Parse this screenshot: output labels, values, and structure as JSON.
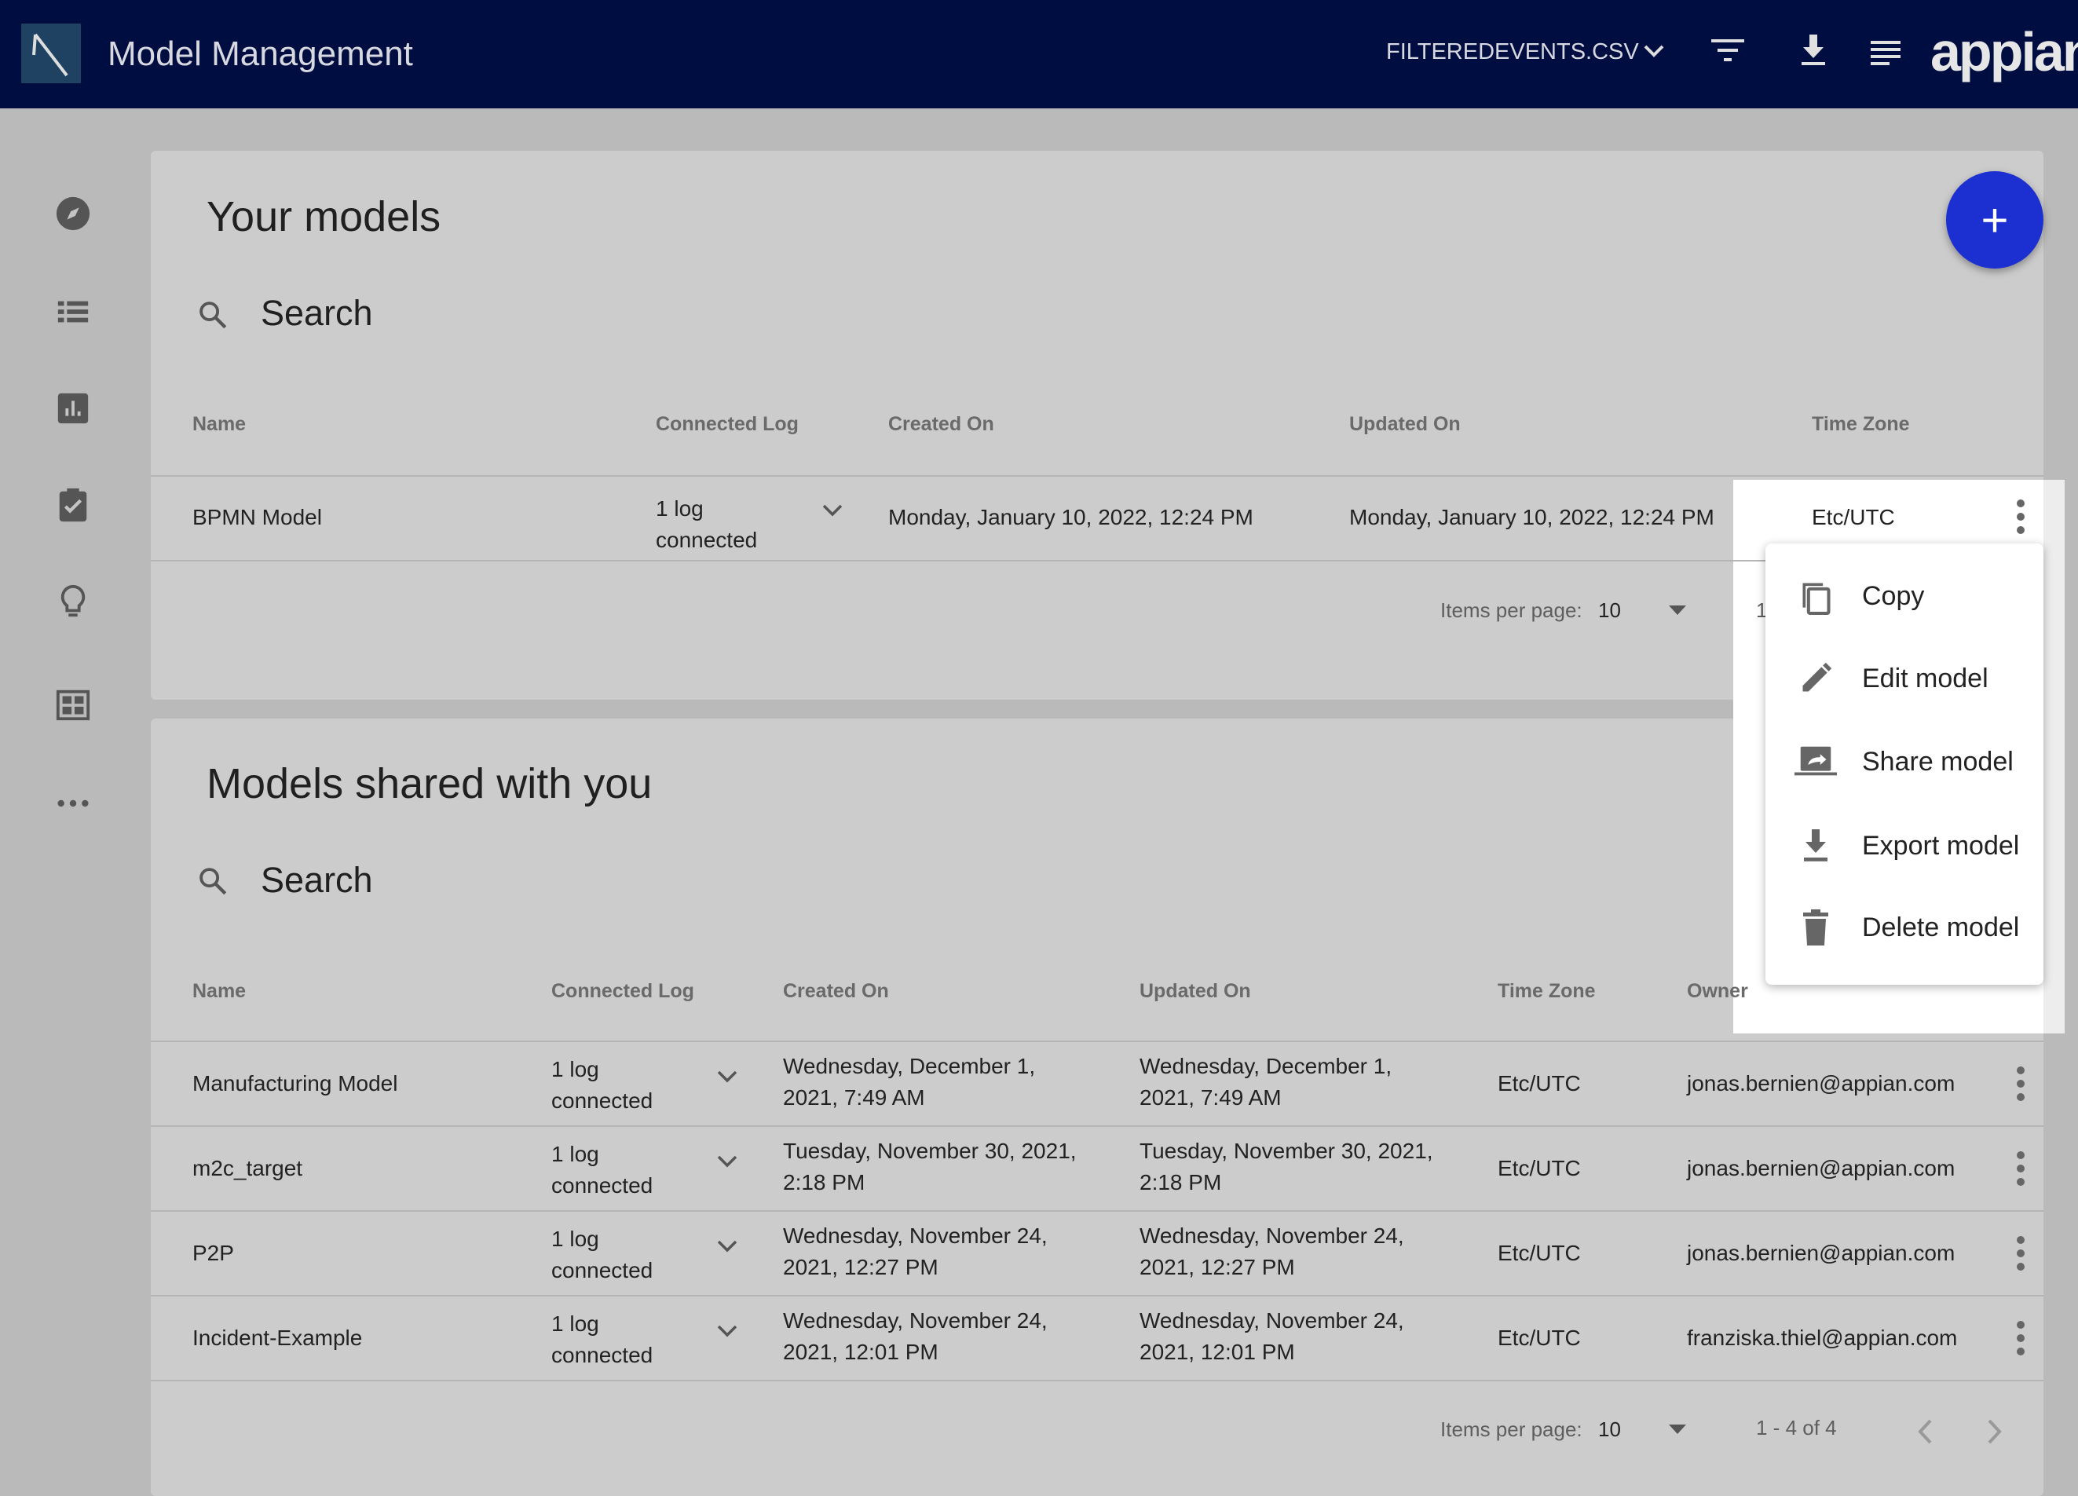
{
  "header": {
    "title": "Model Management",
    "file_label": "FILTEREDEVENTS.CSV",
    "brand": "appian",
    "icons": [
      "chevron-down-icon",
      "filter-icon",
      "download-icon",
      "notes-icon"
    ]
  },
  "sidebar": {
    "icons": [
      "compass-icon",
      "list-icon",
      "chart-icon",
      "clipboard-check-icon",
      "lightbulb-icon",
      "dashboard-icon",
      "more-icon"
    ]
  },
  "your_models": {
    "title": "Your models",
    "search_placeholder": "Search",
    "columns": [
      "Name",
      "Connected Log",
      "Created On",
      "Updated On",
      "Time Zone"
    ],
    "rows": [
      {
        "name": "BPMN Model",
        "log_line1": "1 log",
        "log_line2": "connected",
        "created": "Monday, January 10, 2022, 12:24 PM",
        "updated": "Monday, January 10, 2022, 12:24 PM",
        "tz": "Etc/UTC"
      }
    ],
    "pagination": {
      "label": "Items per page:",
      "value": "10",
      "range": "1"
    }
  },
  "shared_models": {
    "title": "Models shared with you",
    "search_placeholder": "Search",
    "columns": [
      "Name",
      "Connected Log",
      "Created On",
      "Updated On",
      "Time Zone",
      "Owner"
    ],
    "rows": [
      {
        "name": "Manufacturing Model",
        "log_line1": "1 log",
        "log_line2": "connected",
        "created1": "Wednesday, December 1,",
        "created2": "2021, 7:49 AM",
        "updated1": "Wednesday, December 1,",
        "updated2": "2021, 7:49 AM",
        "tz": "Etc/UTC",
        "owner": "jonas.bernien@appian.com"
      },
      {
        "name": "m2c_target",
        "log_line1": "1 log",
        "log_line2": "connected",
        "created1": "Tuesday, November 30, 2021,",
        "created2": "2:18 PM",
        "updated1": "Tuesday, November 30, 2021,",
        "updated2": "2:18 PM",
        "tz": "Etc/UTC",
        "owner": "jonas.bernien@appian.com"
      },
      {
        "name": "P2P",
        "log_line1": "1 log",
        "log_line2": "connected",
        "created1": "Wednesday, November 24,",
        "created2": "2021, 12:27 PM",
        "updated1": "Wednesday, November 24,",
        "updated2": "2021, 12:27 PM",
        "tz": "Etc/UTC",
        "owner": "jonas.bernien@appian.com"
      },
      {
        "name": "Incident-Example",
        "log_line1": "1 log",
        "log_line2": "connected",
        "created1": "Wednesday, November 24,",
        "created2": "2021, 12:01 PM",
        "updated1": "Wednesday, November 24,",
        "updated2": "2021, 12:01 PM",
        "tz": "Etc/UTC",
        "owner": "franziska.thiel@appian.com"
      }
    ],
    "pagination": {
      "label": "Items per page:",
      "value": "10",
      "range": "1 - 4 of 4"
    }
  },
  "fab": {
    "label": "+",
    "color": "#1c2fd0"
  },
  "context_menu": {
    "items": [
      {
        "label": "Copy",
        "icon": "copy-icon"
      },
      {
        "label": "Edit model",
        "icon": "pencil-icon"
      },
      {
        "label": "Share model",
        "icon": "share-icon"
      },
      {
        "label": "Export model",
        "icon": "download-icon"
      },
      {
        "label": "Delete model",
        "icon": "trash-icon"
      }
    ]
  },
  "colors": {
    "header_bg": "#000d40",
    "accent": "#1c2fd0"
  }
}
